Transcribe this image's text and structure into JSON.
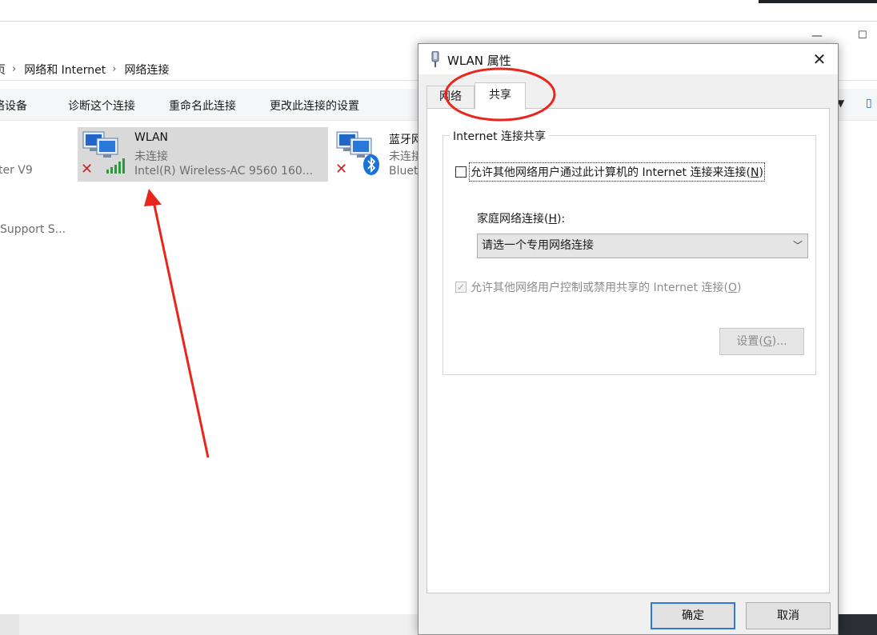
{
  "explorer": {
    "address": {
      "parent_partial": "页",
      "crumb1": "网络和 Internet",
      "crumb2": "网络连接"
    },
    "commands": {
      "disable_partial": "络设备",
      "diagnose": "诊断这个连接",
      "rename": "重命名此连接",
      "change_settings": "更改此连接的设置"
    },
    "left_partials": {
      "adapter_v9": "ter V9",
      "support": "Support S..."
    },
    "wlan_tile": {
      "name": "WLAN",
      "status": "未连接",
      "device": "Intel(R) Wireless-AC 9560 160..."
    },
    "bt_tile": {
      "name_partial": "蓝牙网",
      "status_partial": "未连接",
      "device_partial": "Blueto"
    }
  },
  "dialog": {
    "title": "WLAN 属性",
    "close_glyph": "✕",
    "tabs": {
      "network": "网络",
      "sharing": "共享"
    },
    "group_title": "Internet 连接共享",
    "allow_share": {
      "text": "允许其他网络用户通过此计算机的 Internet 连接来连接(",
      "key": "N",
      "end": ")",
      "checked": false
    },
    "home_label": {
      "text": "家庭网络连接(",
      "key": "H",
      "end": "):"
    },
    "home_select": "请选一个专用网络连接",
    "allow_control": {
      "text": "允许其他网络用户控制或禁用共享的 Internet 连接(",
      "key": "O",
      "end": ")",
      "checked": true,
      "disabled": true
    },
    "settings_btn": {
      "text": "设置(",
      "key": "G",
      "end": ")..."
    },
    "ok": "确定",
    "cancel": "取消"
  },
  "colors": {
    "annotation_red": "#e8261e",
    "accent_blue": "#2f78d6"
  }
}
